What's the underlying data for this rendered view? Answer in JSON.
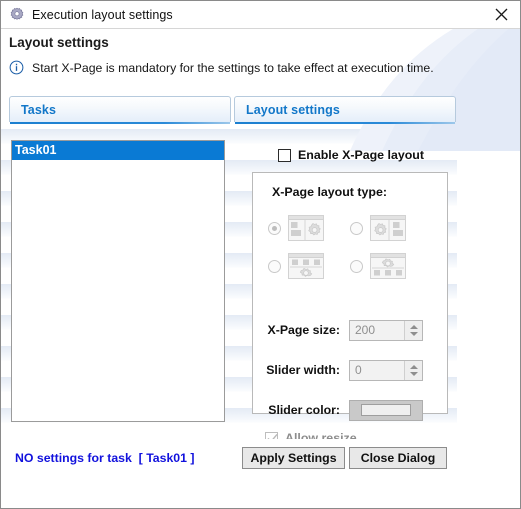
{
  "window": {
    "title": "Execution layout settings",
    "title_icon": "gear-icon",
    "close_icon": "close-icon"
  },
  "header": {
    "title": "Layout settings",
    "info_icon": "info-circle-icon",
    "info_text": "Start X-Page is mandatory for the settings to take effect at execution time."
  },
  "tabs": [
    {
      "label": "Tasks",
      "name": "tab-tasks"
    },
    {
      "label": "Layout settings",
      "name": "tab-layout-settings"
    }
  ],
  "task_list": {
    "items": [
      {
        "label": "Task01",
        "selected": true
      }
    ]
  },
  "settings": {
    "enable_checkbox": {
      "label": "Enable X-Page layout",
      "checked": false
    },
    "group_title": "X-Page layout type:",
    "layout_types": [
      {
        "name": "layout-type-left-panels",
        "selected": true,
        "icon": "thumbnail-panels-left"
      },
      {
        "name": "layout-type-right-panels",
        "selected": false,
        "icon": "thumbnail-panels-right"
      },
      {
        "name": "layout-type-top-panels",
        "selected": false,
        "icon": "thumbnail-panels-top"
      },
      {
        "name": "layout-type-bottom-panels",
        "selected": false,
        "icon": "thumbnail-panels-bottom"
      }
    ],
    "xpage_size": {
      "label": "X-Page size:",
      "value": "200"
    },
    "slider_width": {
      "label": "Slider width:",
      "value": "0"
    },
    "slider_color": {
      "label": "Slider color:",
      "swatch": "#efefef"
    },
    "allow_resize": {
      "label": "Allow resize",
      "checked": true,
      "disabled": true
    }
  },
  "footer": {
    "status": "NO settings for task  [ Task01 ]",
    "apply_button": "Apply Settings",
    "close_button": "Close Dialog"
  },
  "colors": {
    "accent_blue": "#1277c9",
    "selection_blue": "#0a7ad4",
    "status_blue": "#1111dd"
  }
}
